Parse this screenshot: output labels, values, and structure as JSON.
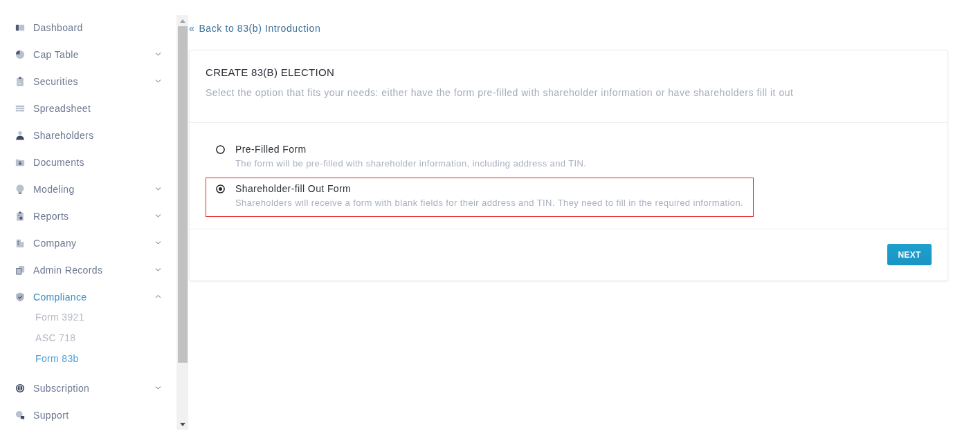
{
  "sidebar": {
    "items": [
      {
        "label": "Dashboard",
        "kind": "link",
        "selected": false
      },
      {
        "label": "Cap Table",
        "kind": "group",
        "expanded": false,
        "selected": false
      },
      {
        "label": "Securities",
        "kind": "group",
        "expanded": false,
        "selected": false
      },
      {
        "label": "Spreadsheet",
        "kind": "link",
        "selected": false
      },
      {
        "label": "Shareholders",
        "kind": "link",
        "selected": false
      },
      {
        "label": "Documents",
        "kind": "link",
        "selected": false
      },
      {
        "label": "Modeling",
        "kind": "group",
        "expanded": false,
        "selected": false
      },
      {
        "label": "Reports",
        "kind": "group",
        "expanded": false,
        "selected": false
      },
      {
        "label": "Company",
        "kind": "group",
        "expanded": false,
        "selected": false
      },
      {
        "label": "Admin Records",
        "kind": "group",
        "expanded": false,
        "selected": false
      },
      {
        "label": "Compliance",
        "kind": "group",
        "expanded": true,
        "selected": true,
        "children": [
          {
            "label": "Form 3921",
            "selected": false
          },
          {
            "label": "ASC 718",
            "selected": false
          },
          {
            "label": "Form 83b",
            "selected": true
          }
        ]
      },
      {
        "label": "Subscription",
        "kind": "group",
        "expanded": false,
        "selected": false
      },
      {
        "label": "Support",
        "kind": "link",
        "selected": false
      }
    ]
  },
  "back_link": {
    "arrow": "«",
    "label": "Back to 83(b) Introduction"
  },
  "election_card": {
    "title": "CREATE 83(B) ELECTION",
    "subtitle": "Select the option that fits your needs: either have the form pre-filled with shareholder information or have shareholders fill it out",
    "options": [
      {
        "label": "Pre-Filled Form",
        "description": "The form will be pre-filled with shareholder information, including address and TIN.",
        "selected": false,
        "highlighted": false
      },
      {
        "label": "Shareholder-fill Out Form",
        "description": "Shareholders will receive a form with blank fields for their address and TIN. They need to fill in the required information.",
        "selected": true,
        "highlighted": true
      }
    ],
    "next_button": "NEXT"
  }
}
